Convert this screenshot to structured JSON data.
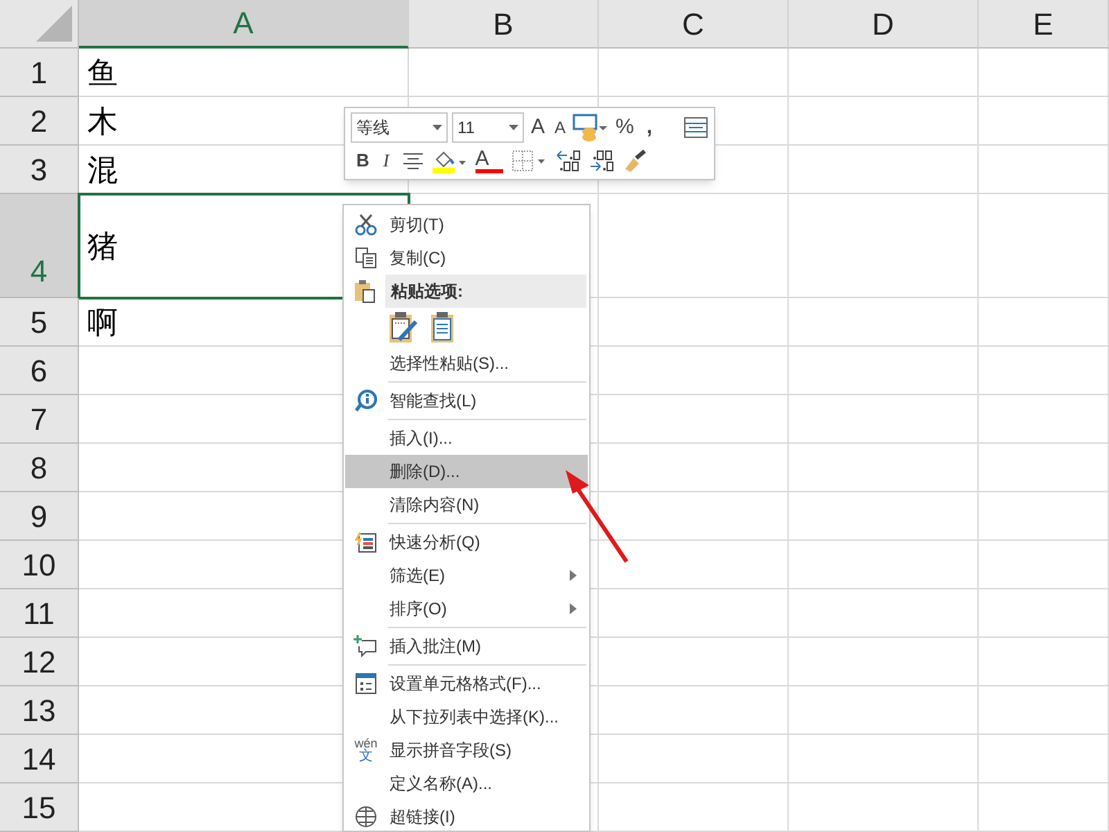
{
  "columns": [
    {
      "label": "A",
      "selected": true
    },
    {
      "label": "B",
      "selected": false
    },
    {
      "label": "C",
      "selected": false
    },
    {
      "label": "D",
      "selected": false
    },
    {
      "label": "E",
      "selected": false
    }
  ],
  "rows": [
    {
      "number": "1",
      "cell_a": "鱼",
      "selected": false
    },
    {
      "number": "2",
      "cell_a": "木",
      "selected": false
    },
    {
      "number": "3",
      "cell_a": "混",
      "selected": false
    },
    {
      "number": "4",
      "cell_a": "猪",
      "selected": true
    },
    {
      "number": "5",
      "cell_a": "啊",
      "selected": false
    },
    {
      "number": "6",
      "selected": false
    },
    {
      "number": "7",
      "selected": false
    },
    {
      "number": "8",
      "selected": false
    },
    {
      "number": "9",
      "selected": false
    },
    {
      "number": "10",
      "selected": false
    },
    {
      "number": "11",
      "selected": false
    },
    {
      "number": "12",
      "selected": false
    },
    {
      "number": "13",
      "selected": false
    },
    {
      "number": "14",
      "selected": false
    },
    {
      "number": "15",
      "selected": false
    }
  ],
  "mini_toolbar": {
    "font": "等线",
    "size": "11",
    "grow_font": "A",
    "shrink_font": "A",
    "percent": "%",
    "comma": ",",
    "bold": "B",
    "italic": "I",
    "font_color": "A"
  },
  "context_menu": [
    {
      "kind": "item",
      "label": "剪切(T)",
      "selected": false
    },
    {
      "kind": "item",
      "label": "复制(C)",
      "selected": false
    },
    {
      "kind": "header",
      "label": "粘贴选项:"
    },
    {
      "kind": "paste-options"
    },
    {
      "kind": "item",
      "label": "选择性粘贴(S)...",
      "selected": false
    },
    {
      "kind": "separator"
    },
    {
      "kind": "item",
      "label": "智能查找(L)",
      "selected": false
    },
    {
      "kind": "separator"
    },
    {
      "kind": "item",
      "label": "插入(I)...",
      "selected": false
    },
    {
      "kind": "item",
      "label": "删除(D)...",
      "selected": true
    },
    {
      "kind": "item",
      "label": "清除内容(N)",
      "selected": false
    },
    {
      "kind": "separator"
    },
    {
      "kind": "item",
      "label": "快速分析(Q)",
      "selected": false
    },
    {
      "kind": "item",
      "label": "筛选(E)",
      "selected": false,
      "submenu": true
    },
    {
      "kind": "item",
      "label": "排序(O)",
      "selected": false,
      "submenu": true
    },
    {
      "kind": "separator"
    },
    {
      "kind": "item",
      "label": "插入批注(M)",
      "selected": false
    },
    {
      "kind": "separator"
    },
    {
      "kind": "item",
      "label": "设置单元格格式(F)...",
      "selected": false
    },
    {
      "kind": "item",
      "label": "从下拉列表中选择(K)...",
      "selected": false
    },
    {
      "kind": "item",
      "label": "显示拼音字段(S)",
      "selected": false,
      "icon_text": [
        "wén",
        "文"
      ]
    },
    {
      "kind": "item",
      "label": "定义名称(A)...",
      "selected": false
    },
    {
      "kind": "item",
      "label": "超链接(I)",
      "selected": false
    }
  ]
}
